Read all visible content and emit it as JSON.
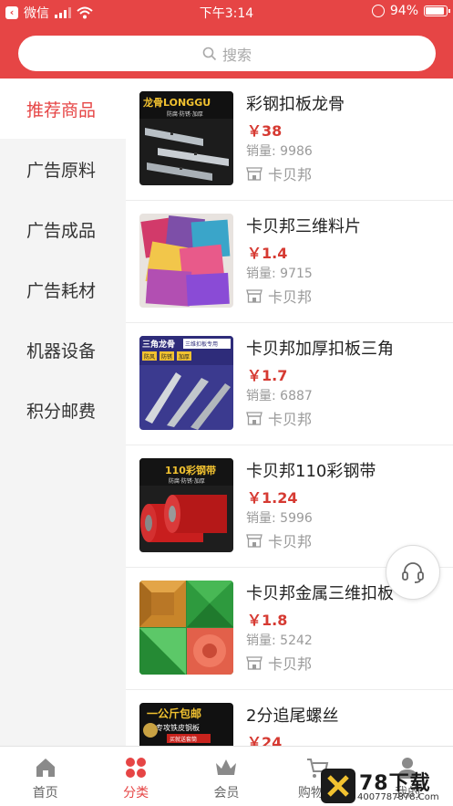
{
  "status_bar": {
    "carrier": "微信",
    "time": "下午3:14",
    "battery": "94%"
  },
  "search": {
    "placeholder": "搜索"
  },
  "sidebar": {
    "items": [
      {
        "label": "推荐商品",
        "active": true
      },
      {
        "label": "广告原料",
        "active": false
      },
      {
        "label": "广告成品",
        "active": false
      },
      {
        "label": "广告耗材",
        "active": false
      },
      {
        "label": "机器设备",
        "active": false
      },
      {
        "label": "积分邮费",
        "active": false
      }
    ]
  },
  "products": [
    {
      "title": "彩钢扣板龙骨",
      "price": "￥38",
      "sales": "销量: 9986",
      "shop": "卡贝邦",
      "thumb_text": "龙骨LONGGU",
      "thumb_sub": "防腐·防锈·加厚"
    },
    {
      "title": "卡贝邦三维料片",
      "price": "￥1.4",
      "sales": "销量: 9715",
      "shop": "卡贝邦"
    },
    {
      "title": "卡贝邦加厚扣板三角",
      "price": "￥1.7",
      "sales": "销量: 6887",
      "shop": "卡贝邦",
      "thumb_text": "三角龙骨",
      "thumb_sub": "三维扣板专用",
      "thumb_tags": [
        "防风",
        "防锈",
        "加厚"
      ]
    },
    {
      "title": "卡贝邦110彩钢带",
      "price": "￥1.24",
      "sales": "销量: 5996",
      "shop": "卡贝邦",
      "thumb_text": "110彩钢带",
      "thumb_sub": "防腐·防锈·加厚"
    },
    {
      "title": "卡贝邦金属三维扣板",
      "price": "￥1.8",
      "sales": "销量: 5242",
      "shop": "卡贝邦"
    },
    {
      "title": "2分追尾螺丝",
      "price": "￥24",
      "sales": "",
      "shop": "",
      "thumb_text": "一公斤包邮",
      "thumb_sub": "专攻铁皮钢板",
      "thumb_tag": "买就送套筒"
    }
  ],
  "tabbar": {
    "items": [
      {
        "label": "首页",
        "icon": "home-icon",
        "active": false
      },
      {
        "label": "分类",
        "icon": "category-icon",
        "active": true
      },
      {
        "label": "会员",
        "icon": "crown-icon",
        "active": false
      },
      {
        "label": "购物车",
        "icon": "cart-icon",
        "active": false
      },
      {
        "label": "我的",
        "icon": "user-icon",
        "active": false
      }
    ]
  },
  "watermark": {
    "title": "78下载",
    "url": "4007787878.Com"
  },
  "colors": {
    "accent": "#e64545",
    "price": "#d63a32",
    "sidebar_bg": "#f4f4f4"
  }
}
